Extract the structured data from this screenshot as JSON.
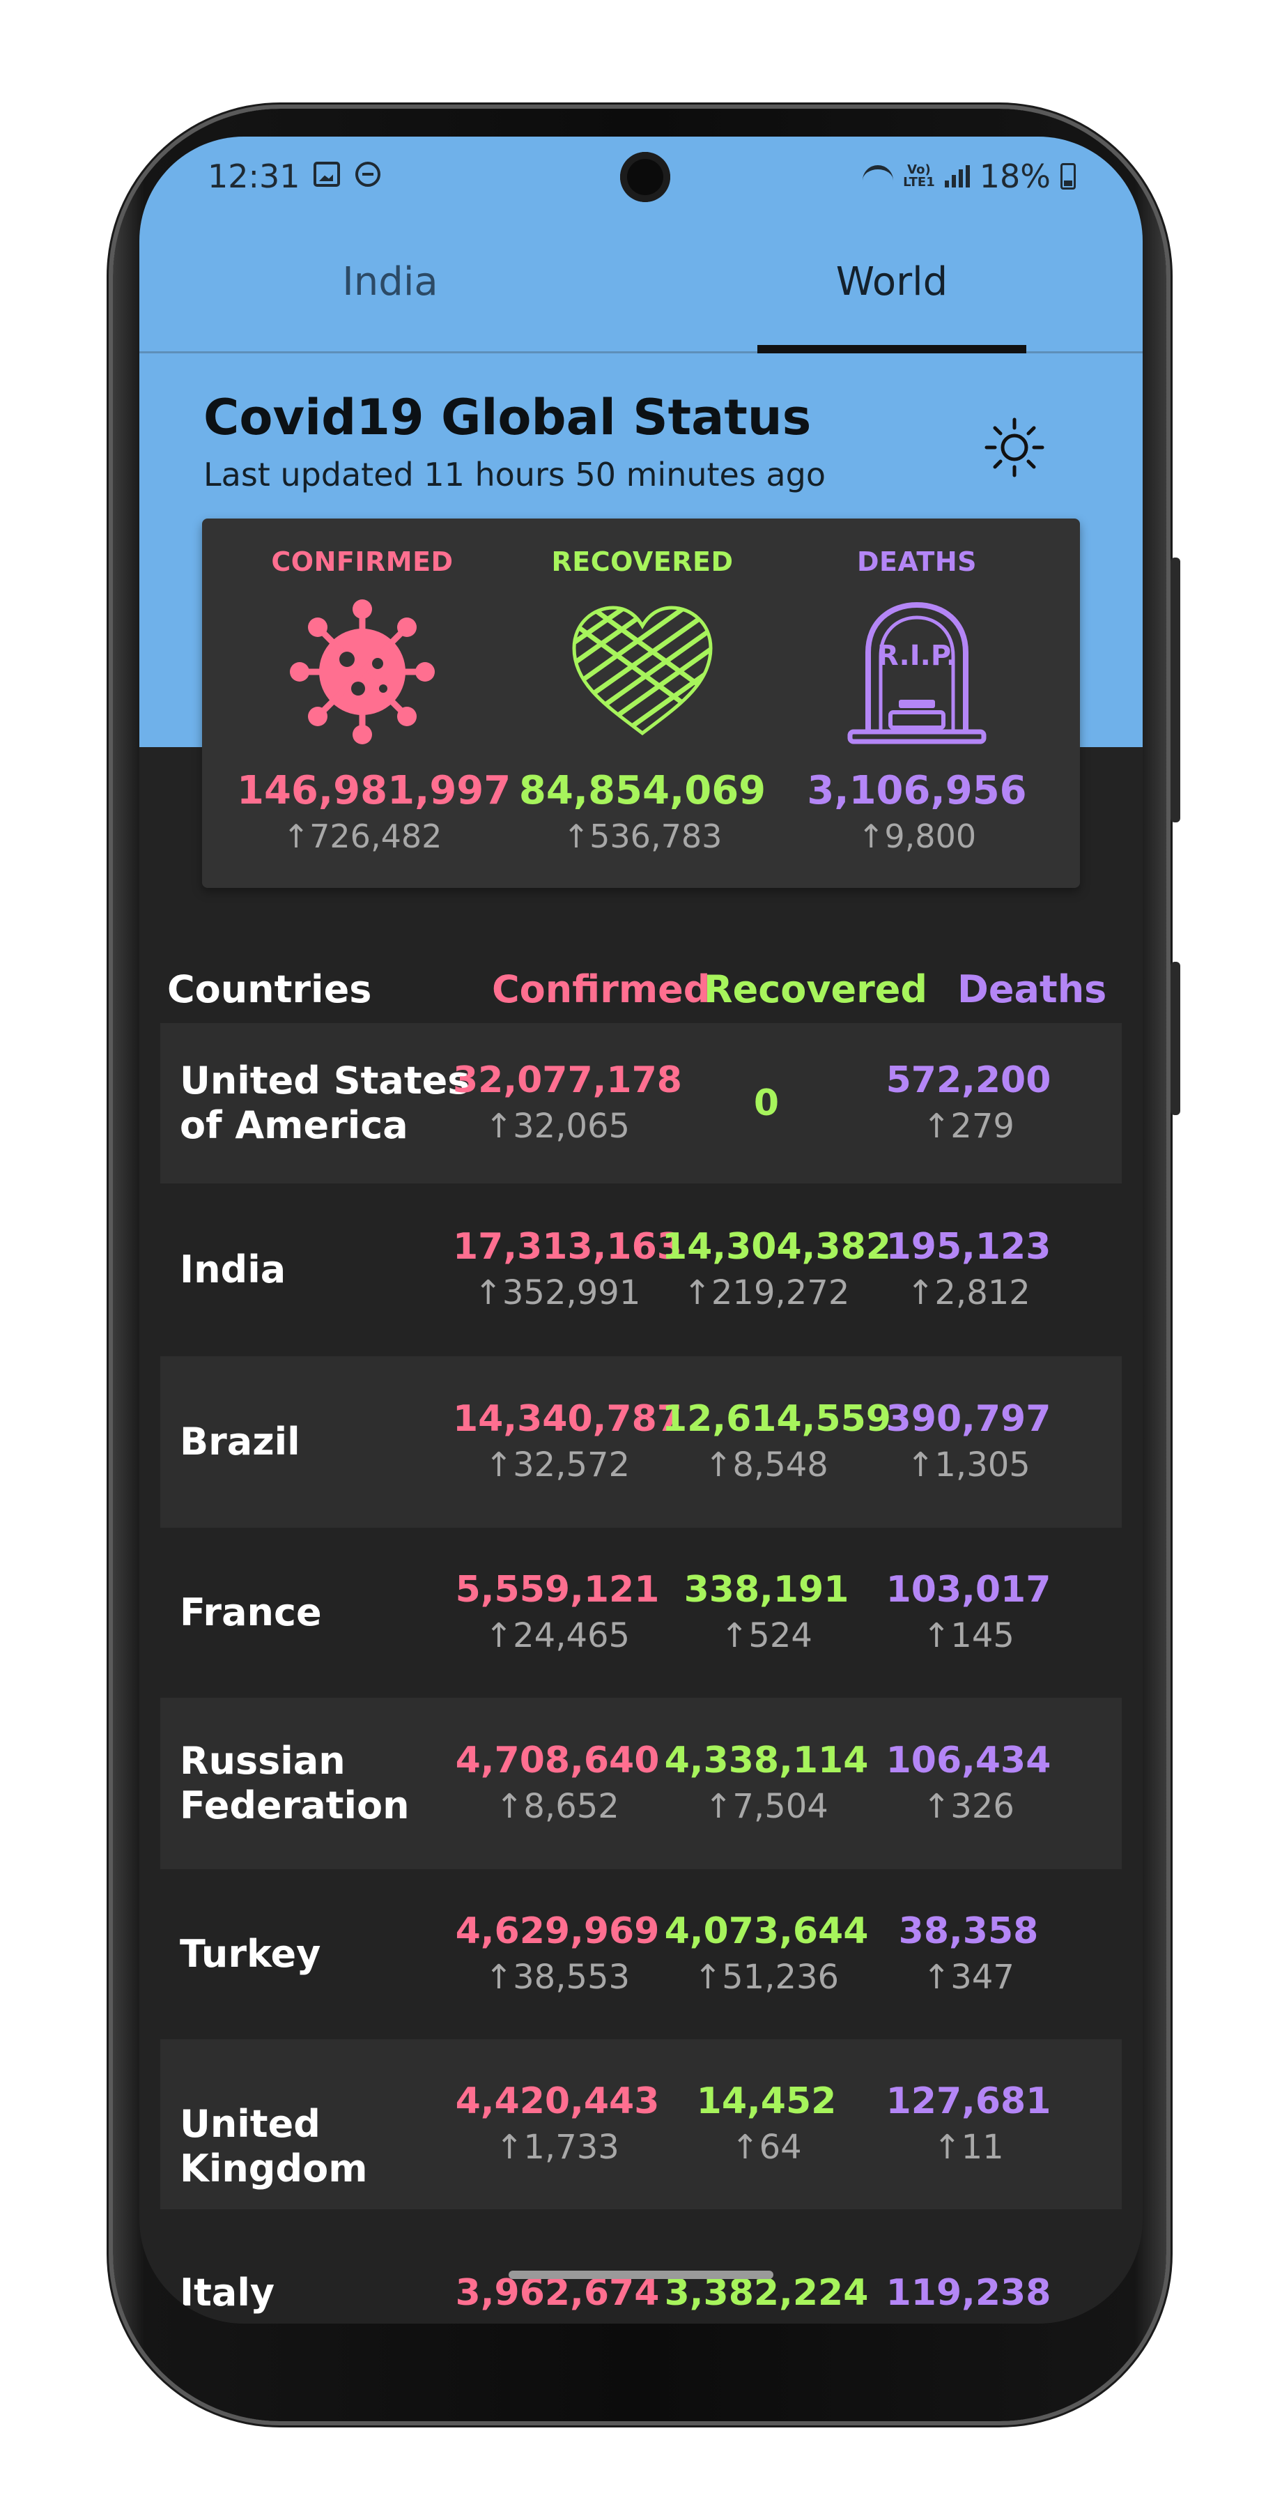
{
  "status_bar": {
    "time": "12:31",
    "volte": "Vo)\nLTE1",
    "battery": "18%"
  },
  "tabs": [
    {
      "label": "India"
    },
    {
      "label": "World"
    }
  ],
  "header": {
    "title": "Covid19 Global Status",
    "updated": "Last updated 11 hours 50 minutes ago"
  },
  "colors": {
    "confirmed": "#ff6f90",
    "recovered": "#a7f45c",
    "deaths": "#b486f6",
    "hero": "#6fb1ea"
  },
  "summary": {
    "confirmed": {
      "label": "CONFIRMED",
      "value": "146,981,997",
      "delta": "↑726,482",
      "icon": "virus-icon"
    },
    "recovered": {
      "label": "RECOVERED",
      "value": "84,854,069",
      "delta": "↑536,783",
      "icon": "heart-icon"
    },
    "deaths": {
      "label": "DEATHS",
      "value": "3,106,956",
      "delta": "↑9,800",
      "icon": "tombstone-icon",
      "icon_text": "R.I.P."
    }
  },
  "table": {
    "headers": {
      "country": "Countries",
      "confirmed": "Confirmed",
      "recovered": "Recovered",
      "deaths": "Deaths"
    },
    "rows": [
      {
        "country": "United States of America",
        "confirmed": "32,077,178",
        "confirmed_delta": "↑32,065",
        "recovered": "0",
        "recovered_delta": "",
        "deaths": "572,200",
        "deaths_delta": "↑279"
      },
      {
        "country": "India",
        "confirmed": "17,313,163",
        "confirmed_delta": "↑352,991",
        "recovered": "14,304,382",
        "recovered_delta": "↑219,272",
        "deaths": "195,123",
        "deaths_delta": "↑2,812"
      },
      {
        "country": "Brazil",
        "confirmed": "14,340,787",
        "confirmed_delta": "↑32,572",
        "recovered": "12,614,559",
        "recovered_delta": "↑8,548",
        "deaths": "390,797",
        "deaths_delta": "↑1,305"
      },
      {
        "country": "France",
        "confirmed": "5,559,121",
        "confirmed_delta": "↑24,465",
        "recovered": "338,191",
        "recovered_delta": "↑524",
        "deaths": "103,017",
        "deaths_delta": "↑145"
      },
      {
        "country": "Russian Federation",
        "confirmed": "4,708,640",
        "confirmed_delta": "↑8,652",
        "recovered": "4,338,114",
        "recovered_delta": "↑7,504",
        "deaths": "106,434",
        "deaths_delta": "↑326"
      },
      {
        "country": "Turkey",
        "confirmed": "4,629,969",
        "confirmed_delta": "↑38,553",
        "recovered": "4,073,644",
        "recovered_delta": "↑51,236",
        "deaths": "38,358",
        "deaths_delta": "↑347"
      },
      {
        "country": "United Kingdom",
        "confirmed": "4,420,443",
        "confirmed_delta": "↑1,733",
        "recovered": "14,452",
        "recovered_delta": "↑64",
        "deaths": "127,681",
        "deaths_delta": "↑11"
      },
      {
        "country": "Italy",
        "confirmed": "3,962,674",
        "confirmed_delta": "",
        "recovered": "3,382,224",
        "recovered_delta": "",
        "deaths": "119,238",
        "deaths_delta": ""
      }
    ]
  }
}
